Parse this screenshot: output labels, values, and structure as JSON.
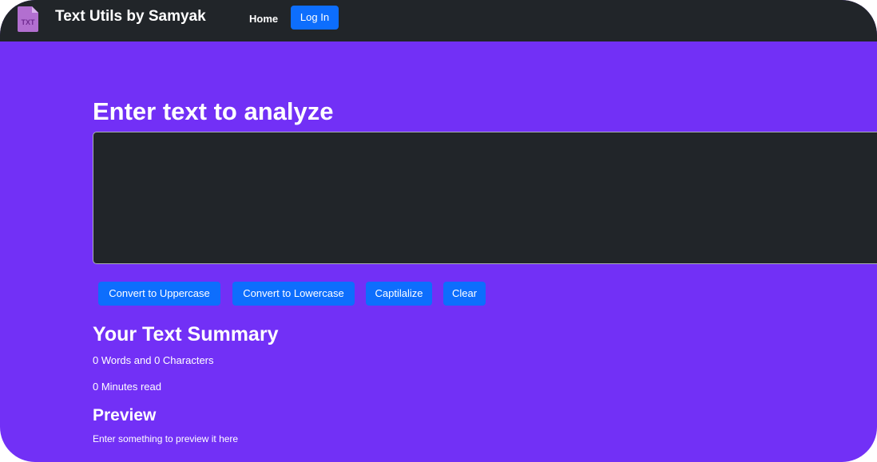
{
  "navbar": {
    "logo_icon_text": "TXT",
    "brand": "Text Utils by Samyak",
    "home_label": "Home",
    "login_label": "Log In"
  },
  "main": {
    "heading": "Enter text to analyze",
    "textarea_value": "",
    "buttons": {
      "uppercase": "Convert to Uppercase",
      "lowercase": "Convert to Lowercase",
      "capitalize": "Captilalize",
      "clear": "Clear"
    },
    "summary": {
      "title": "Your Text Summary",
      "words_chars": "0 Words and 0 Characters",
      "minutes": "0 Minutes read"
    },
    "preview": {
      "title": "Preview",
      "text": "Enter something to preview it here"
    }
  },
  "colors": {
    "navbar_bg": "#212529",
    "page_bg": "#7230f6",
    "button_bg": "#0d6efd",
    "textarea_bg": "#212529",
    "logo_file": "#b26fd0",
    "logo_text": "#6f2a8f"
  },
  "icons": {
    "logo": "txt-file-icon"
  }
}
